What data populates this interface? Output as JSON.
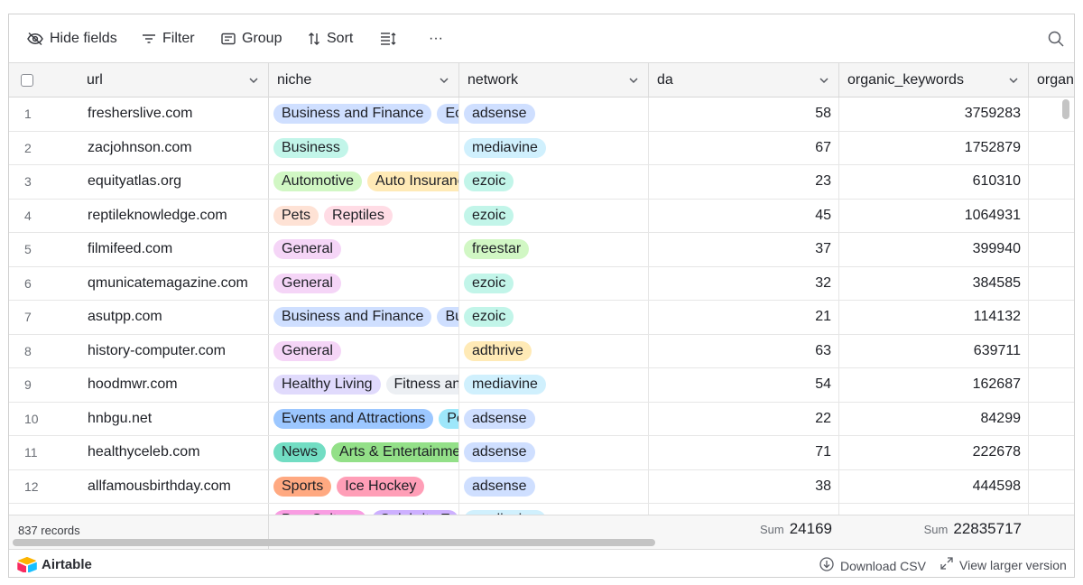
{
  "toolbar": {
    "hide_fields": "Hide fields",
    "filter": "Filter",
    "group": "Group",
    "sort": "Sort",
    "more": "···"
  },
  "columns": [
    "url",
    "niche",
    "network",
    "da",
    "organic_keywords",
    "organ"
  ],
  "rows": [
    {
      "n": "1",
      "url": "fresherslive.com",
      "niche": [
        {
          "t": "Business and Finance",
          "c": "#cfdfff"
        },
        {
          "t": "Eco",
          "c": "#cfdfff"
        }
      ],
      "network": {
        "t": "adsense",
        "c": "#cfdfff"
      },
      "da": "58",
      "ok": "3759283"
    },
    {
      "n": "2",
      "url": "zacjohnson.com",
      "niche": [
        {
          "t": "Business",
          "c": "#c2f5e9"
        }
      ],
      "network": {
        "t": "mediavine",
        "c": "#d0f0fd"
      },
      "da": "67",
      "ok": "1752879"
    },
    {
      "n": "3",
      "url": "equityatlas.org",
      "niche": [
        {
          "t": "Automotive",
          "c": "#d1f7c4"
        },
        {
          "t": "Auto Insurance",
          "c": "#ffeab6"
        }
      ],
      "network": {
        "t": "ezoic",
        "c": "#c2f5e9"
      },
      "da": "23",
      "ok": "610310"
    },
    {
      "n": "4",
      "url": "reptileknowledge.com",
      "niche": [
        {
          "t": "Pets",
          "c": "#fee2d5"
        },
        {
          "t": "Reptiles",
          "c": "#ffdce5"
        }
      ],
      "network": {
        "t": "ezoic",
        "c": "#c2f5e9"
      },
      "da": "45",
      "ok": "1064931"
    },
    {
      "n": "5",
      "url": "filmifeed.com",
      "niche": [
        {
          "t": "General",
          "c": "#f5d5f7"
        }
      ],
      "network": {
        "t": "freestar",
        "c": "#d1f7c4"
      },
      "da": "37",
      "ok": "399940"
    },
    {
      "n": "6",
      "url": "qmunicatemagazine.com",
      "niche": [
        {
          "t": "General",
          "c": "#f5d5f7"
        }
      ],
      "network": {
        "t": "ezoic",
        "c": "#c2f5e9"
      },
      "da": "32",
      "ok": "384585"
    },
    {
      "n": "7",
      "url": "asutpp.com",
      "niche": [
        {
          "t": "Business and Finance",
          "c": "#cfdfff"
        },
        {
          "t": "Bu",
          "c": "#cfdfff"
        }
      ],
      "network": {
        "t": "ezoic",
        "c": "#c2f5e9"
      },
      "da": "21",
      "ok": "114132"
    },
    {
      "n": "8",
      "url": "history-computer.com",
      "niche": [
        {
          "t": "General",
          "c": "#f5d5f7"
        }
      ],
      "network": {
        "t": "adthrive",
        "c": "#ffeab6"
      },
      "da": "63",
      "ok": "639711"
    },
    {
      "n": "9",
      "url": "hoodmwr.com",
      "niche": [
        {
          "t": "Healthy Living",
          "c": "#e0dafc"
        },
        {
          "t": "Fitness an",
          "c": "#eceff3"
        }
      ],
      "network": {
        "t": "mediavine",
        "c": "#d0f0fd"
      },
      "da": "54",
      "ok": "162687"
    },
    {
      "n": "10",
      "url": "hnbgu.net",
      "niche": [
        {
          "t": "Events and Attractions",
          "c": "#9cc7ff"
        },
        {
          "t": "Pe",
          "c": "#9ee7fa"
        }
      ],
      "network": {
        "t": "adsense",
        "c": "#cfdfff"
      },
      "da": "22",
      "ok": "84299"
    },
    {
      "n": "11",
      "url": "healthyceleb.com",
      "niche": [
        {
          "t": "News",
          "c": "#72ddc3"
        },
        {
          "t": "Arts & Entertainment",
          "c": "#93e088"
        }
      ],
      "network": {
        "t": "adsense",
        "c": "#cfdfff"
      },
      "da": "71",
      "ok": "222678"
    },
    {
      "n": "12",
      "url": "allfamousbirthday.com",
      "niche": [
        {
          "t": "Sports",
          "c": "#ffa981"
        },
        {
          "t": "Ice Hockey",
          "c": "#ff9eb7"
        }
      ],
      "network": {
        "t": "adsense",
        "c": "#cfdfff"
      },
      "da": "38",
      "ok": "444598"
    }
  ],
  "partial_row": {
    "niche": [
      {
        "t": "Pop Culture",
        "c": "#f99de2"
      },
      {
        "t": "Celebrity E",
        "c": "#cdb0ff"
      }
    ],
    "network": {
      "t": "mediavine",
      "c": "#d0f0fd"
    }
  },
  "summary": {
    "records": "837 records",
    "sum_label": "Sum",
    "da_sum": "24169",
    "ok_sum": "22835717"
  },
  "footer": {
    "brand": "Airtable",
    "download": "Download CSV",
    "view_larger": "View larger version"
  },
  "icons": {
    "hide_fields": "eye-slash-icon",
    "filter": "filter-icon",
    "group": "group-icon",
    "sort": "sort-icon",
    "row_height": "row-height-icon",
    "search": "search-icon",
    "download": "download-icon",
    "expand": "expand-icon"
  }
}
